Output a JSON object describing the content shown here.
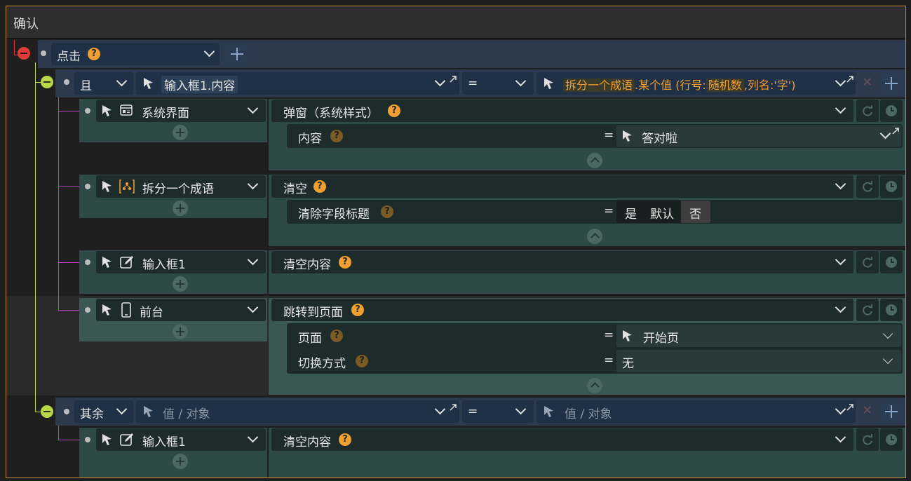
{
  "header": {
    "title": "确认"
  },
  "trigger": {
    "label": "点击"
  },
  "condition_if": {
    "operator": "且",
    "left_value": "输入框1.内容",
    "compare": "=",
    "right_parts": [
      "拆分一个成语",
      ".某个值 (行号:",
      "随机数",
      ",列名:'字')"
    ]
  },
  "actions": [
    {
      "target": "系统界面",
      "target_icon": "window-icon",
      "action": "弹窗（系统样式）",
      "params": [
        {
          "label": "内容",
          "eq": "=",
          "value": "答对啦"
        }
      ]
    },
    {
      "target": "拆分一个成语",
      "target_icon": "dataset-icon",
      "action": "清空",
      "params": [
        {
          "label": "清除字段标题",
          "eq": "=",
          "options": [
            "是",
            "默认",
            "否"
          ],
          "selected": "否"
        }
      ]
    },
    {
      "target": "输入框1",
      "target_icon": "edit-icon",
      "action": "清空内容",
      "params": []
    },
    {
      "target": "前台",
      "target_icon": "phone-icon",
      "action": "跳转到页面",
      "params": [
        {
          "label": "页面",
          "eq": "=",
          "value": "开始页"
        },
        {
          "label": "切换方式",
          "eq": "=",
          "value": "无"
        }
      ]
    }
  ],
  "condition_else": {
    "operator": "其余",
    "left_placeholder": "值 / 对象",
    "compare": "=",
    "right_placeholder": "值 / 对象"
  },
  "else_actions": [
    {
      "target": "输入框1",
      "target_icon": "edit-icon",
      "action": "清空内容"
    }
  ],
  "colors": {
    "accent": "#f0a030",
    "border": "#c08a2a",
    "remove": "#e03a3a",
    "branch": "#b8d84a",
    "link": "#c040c0"
  }
}
